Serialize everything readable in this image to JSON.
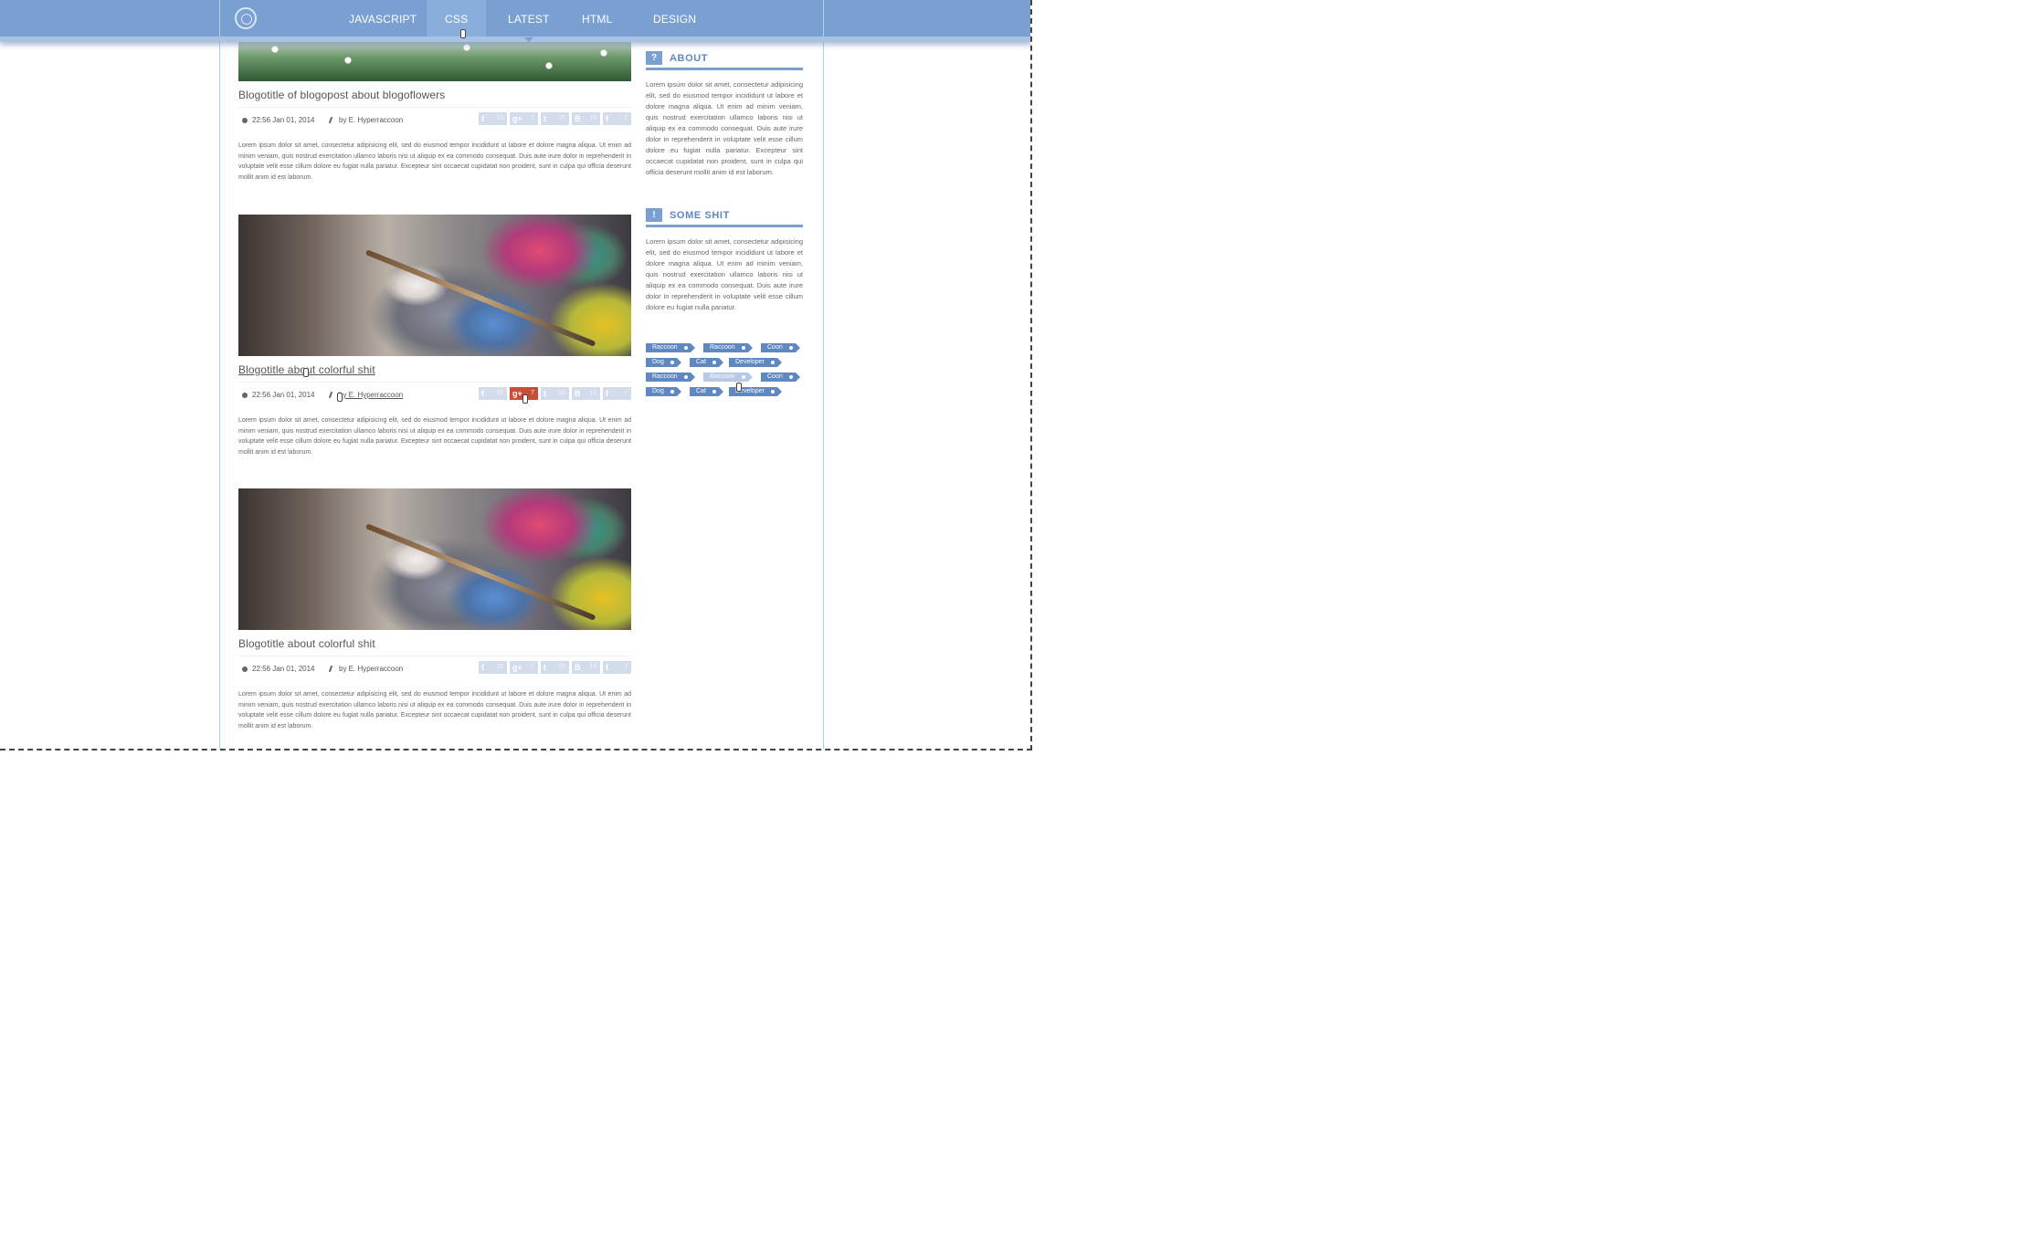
{
  "nav": {
    "items": [
      "JAVASCRIPT",
      "CSS",
      "LATEST",
      "HTML",
      "DESIGN"
    ],
    "active_hover": "CSS",
    "current": "LATEST"
  },
  "posts": [
    {
      "title": "Blogotitle of blogopost about blogoflowers",
      "datetime": "22:56 Jan 01, 2014",
      "author": "by E. Hyperraccoon",
      "shares": [
        {
          "icon": "f",
          "count": "16"
        },
        {
          "icon": "g+",
          "count": "7"
        },
        {
          "icon": "t",
          "count": "15"
        },
        {
          "icon": "B",
          "count": "16"
        },
        {
          "icon": "f",
          "count": "7"
        }
      ],
      "excerpt": "Lorem ipsum dolor sit amet, consectetur adipisicing elit, sed do eiusmod tempor incididunt ut labore et dolore magna aliqua. Ut enim ad minim veniam, quis nostrud exercitation ullamco laboris nisi ut aliquip ex ea commodo consequat. Duis aute irure dolor in reprehenderit in voluptate velit esse cillum dolore eu fugiat nulla pariatur. Excepteur sint occaecat cupidatat non proident, sunt in culpa qui officia deserunt mollit anim id est laborum."
    },
    {
      "title": "Blogotitle about colorful shit",
      "datetime": "22:56 Jan 01, 2014",
      "author": "by E. Hyperraccoon",
      "shares": [
        {
          "icon": "f",
          "count": "16"
        },
        {
          "icon": "g+",
          "count": "7"
        },
        {
          "icon": "t",
          "count": "15"
        },
        {
          "icon": "B",
          "count": "16"
        },
        {
          "icon": "f",
          "count": "7"
        }
      ],
      "excerpt": "Lorem ipsum dolor sit amet, consectetur adipisicing elit, sed do eiusmod tempor incididunt ut labore et dolore magna aliqua. Ut enim ad minim veniam, quis nostrud exercitation ullamco laboris nisi ut aliquip ex ea commodo consequat. Duis aute irure dolor in reprehenderit in voluptate velit esse cillum dolore eu fugiat nulla pariatur. Excepteur sint occaecat cupidatat non proident, sunt in culpa qui officia deserunt mollit anim id est laborum."
    },
    {
      "title": "Blogotitle about colorful shit",
      "datetime": "22:56 Jan 01, 2014",
      "author": "by E. Hyperraccoon",
      "shares": [
        {
          "icon": "f",
          "count": "16"
        },
        {
          "icon": "g+",
          "count": "7"
        },
        {
          "icon": "t",
          "count": "15"
        },
        {
          "icon": "B",
          "count": "16"
        },
        {
          "icon": "f",
          "count": "7"
        }
      ],
      "excerpt": "Lorem ipsum dolor sit amet, consectetur adipisicing elit, sed do eiusmod tempor incididunt ut labore et dolore magna aliqua. Ut enim ad minim veniam, quis nostrud exercitation ullamco laboris nisi ut aliquip ex ea commodo consequat. Duis aute irure dolor in reprehenderit in voluptate velit esse cillum dolore eu fugiat nulla pariatur. Excepteur sint occaecat cupidatat non proident, sunt in culpa qui officia deserunt mollit anim id est laborum."
    }
  ],
  "sidebar": {
    "about": {
      "icon": "?",
      "title": "ABOUT",
      "text": "Lorem ipsum dolor sit amet, consectetur adipisicing elit, sed do eiusmod tempor incididunt ut labore et dolore magna aliqua. Ut enim ad minim veniam, quis nostrud exercitation ullamco laboris nisi ut aliquip ex ea commodo consequat. Duis aute irure dolor in reprehenderit in voluptate velit esse cillum dolore eu fugiat nulla pariatur. Excepteur sint occaecat cupidatat non proident, sunt in culpa qui officia deserunt mollit anim id est laborum."
    },
    "some_shit": {
      "icon": "!",
      "title": "SOME SHIT",
      "text": "Lorem ipsum dolor sit amet, consectetur adipisicing elit, sed do eiusmod tempor incididunt ut labore et dolore magna aliqua. Ut enim ad minim veniam, quis nostrud exercitation ullamco laboris nisi ut aliquip ex ea commodo consequat. Duis aute irure dolor in reprehenderit in voluptate velit esse cillum dolore eu fugiat nulla pariatur."
    },
    "tags": [
      "Raccoon",
      "Raccoon",
      "Coon",
      "Dog",
      "Cat",
      "Developer",
      "Raccoon",
      "Raccoon",
      "Coon",
      "Dog",
      "Cat",
      "Developer"
    ]
  },
  "colors": {
    "accent": "#7aa0d2",
    "accent_dark": "#5f87c0",
    "share_bg": "#d3dceb",
    "share_active": "#c84f36",
    "guide": "#9ed9e8"
  }
}
